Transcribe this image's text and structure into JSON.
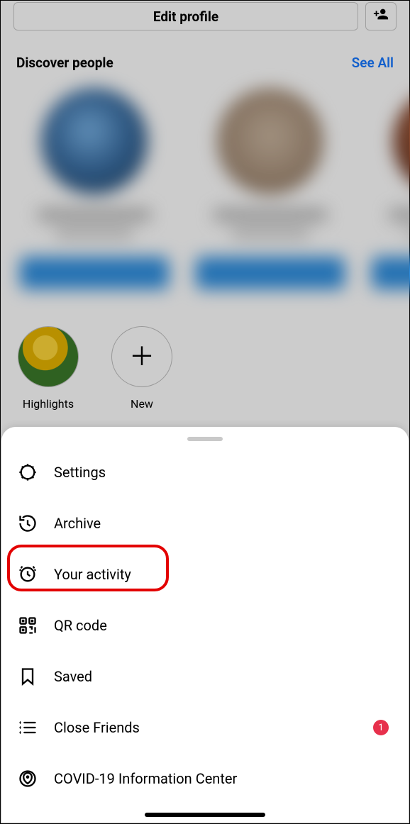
{
  "header": {
    "edit_profile_label": "Edit profile"
  },
  "discover": {
    "title": "Discover people",
    "see_all_label": "See All"
  },
  "highlights": {
    "items": [
      {
        "label": "Highlights"
      },
      {
        "label": "New"
      }
    ]
  },
  "sheet": {
    "items": [
      {
        "icon": "settings-icon",
        "label": "Settings"
      },
      {
        "icon": "archive-icon",
        "label": "Archive"
      },
      {
        "icon": "activity-icon",
        "label": "Your activity",
        "highlighted": true
      },
      {
        "icon": "qr-code-icon",
        "label": "QR code"
      },
      {
        "icon": "saved-icon",
        "label": "Saved"
      },
      {
        "icon": "close-friends-icon",
        "label": "Close Friends",
        "badge": "1"
      },
      {
        "icon": "covid-info-icon",
        "label": "COVID-19 Information Center"
      }
    ]
  }
}
